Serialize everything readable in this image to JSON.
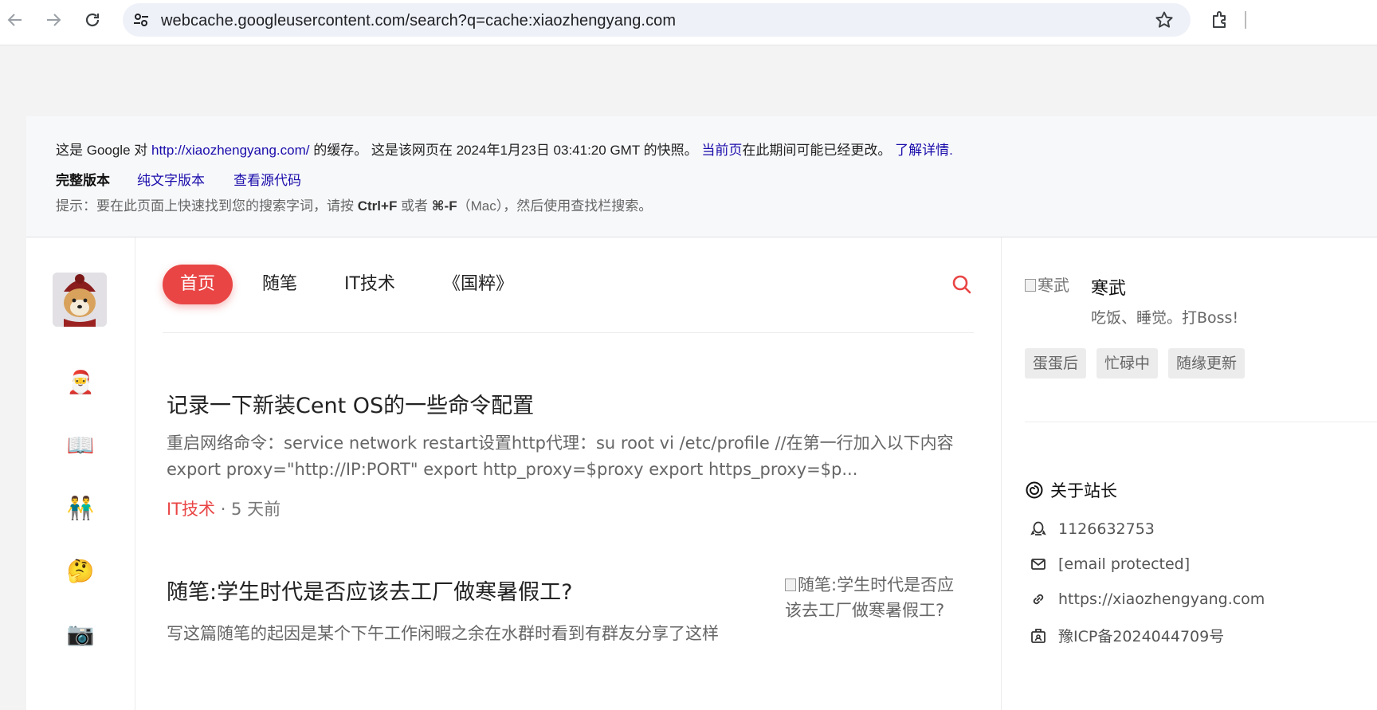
{
  "browser": {
    "url": "webcache.googleusercontent.com/search?q=cache:xiaozhengyang.com"
  },
  "cache_banner": {
    "line1_prefix": "这是 Google 对 ",
    "line1_link": "http://xiaozhengyang.com/",
    "line1_mid": " 的缓存。 这是该网页在 2024年1月23日 03:41:20 GMT 的快照。 ",
    "current_page_link": "当前页",
    "line1_suffix": "在此期间可能已经更改。 ",
    "learn_more_link": "了解详情.",
    "full_version": "完整版本",
    "text_only_link": "纯文字版本",
    "view_source_link": "查看源代码",
    "tip_prefix": "提示：要在此页面上快速找到您的搜索字词，请按 ",
    "tip_key1": "Ctrl+F",
    "tip_mid": " 或者 ",
    "tip_key2": "⌘-F",
    "tip_suffix": "（Mac），然后使用查找栏搜索。"
  },
  "left_sidebar": {
    "emojis": [
      "🎅",
      "📖",
      "👬",
      "🤔",
      "📷"
    ]
  },
  "nav": {
    "items": [
      "首页",
      "随笔",
      "IT技术",
      "《国粹》"
    ]
  },
  "posts": [
    {
      "title": "记录一下新装Cent OS的一些命令配置",
      "excerpt": "重启网络命令：service network restart设置http代理：su root vi /etc/profile //在第一行加入以下内容 export proxy=\"http://IP:PORT\" export http_proxy=$proxy export https_proxy=$p...",
      "category": "IT技术",
      "time": " · 5 天前"
    },
    {
      "title": "随笔:学生时代是否应该去工厂做寒暑假工?",
      "excerpt": "写这篇随笔的起因是某个下午工作闲暇之余在水群时看到有群友分享了这样",
      "thumb_alt": "随笔:学生时代是否应该去工厂做寒暑假工?"
    }
  ],
  "profile": {
    "avatar_alt": "寒武",
    "name": "寒武",
    "motto": "吃饭、睡觉。打Boss!",
    "tags": [
      "蛋蛋后",
      "忙碌中",
      "随缘更新"
    ],
    "about_title": "关于站长",
    "qq": "1126632753",
    "email": "[email protected]",
    "website": "https://xiaozhengyang.com",
    "icp": "豫ICP备2024044709号"
  }
}
